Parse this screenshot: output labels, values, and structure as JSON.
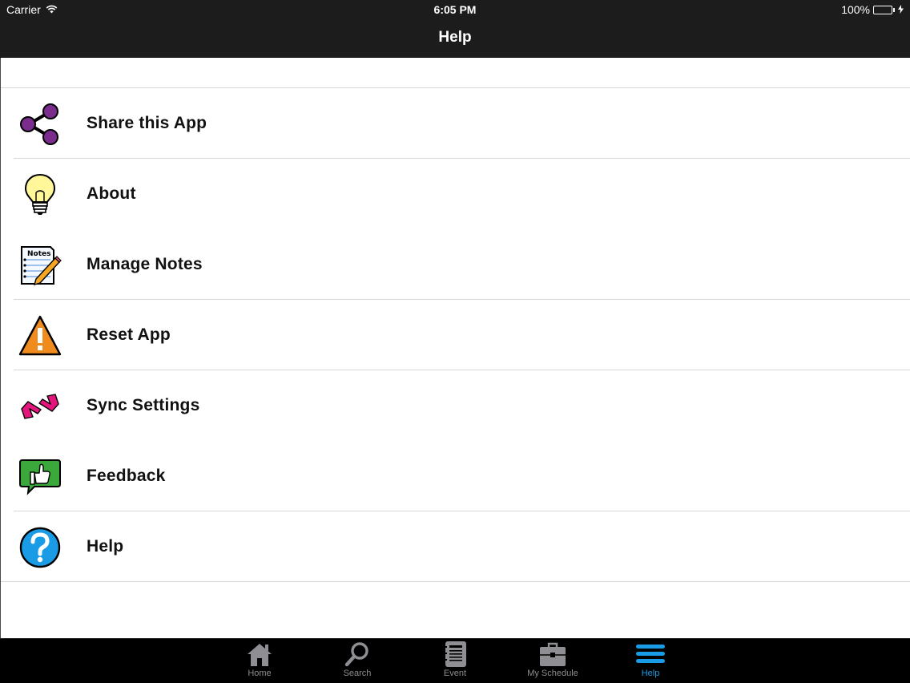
{
  "status_bar": {
    "carrier": "Carrier",
    "time": "6:05 PM",
    "battery": "100%",
    "battery_color": "#4cd964"
  },
  "nav_bar": {
    "title": "Help"
  },
  "menu": {
    "items": [
      {
        "label": "Share this App",
        "icon": "share-icon"
      },
      {
        "label": "About",
        "icon": "lightbulb-icon"
      },
      {
        "label": "Manage Notes",
        "icon": "notes-icon",
        "icon_text": "Notes"
      },
      {
        "label": "Reset App",
        "icon": "warning-icon"
      },
      {
        "label": "Sync Settings",
        "icon": "sync-icon"
      },
      {
        "label": "Feedback",
        "icon": "thumbs-up-icon"
      },
      {
        "label": "Help",
        "icon": "question-icon"
      }
    ]
  },
  "tab_bar": {
    "active_color": "#1a9be6",
    "tabs": [
      {
        "label": "Home",
        "icon": "home-icon"
      },
      {
        "label": "Search",
        "icon": "search-icon"
      },
      {
        "label": "Event",
        "icon": "notebook-icon"
      },
      {
        "label": "My Schedule",
        "icon": "briefcase-icon"
      },
      {
        "label": "Help",
        "icon": "menu-icon",
        "active": true
      }
    ]
  }
}
